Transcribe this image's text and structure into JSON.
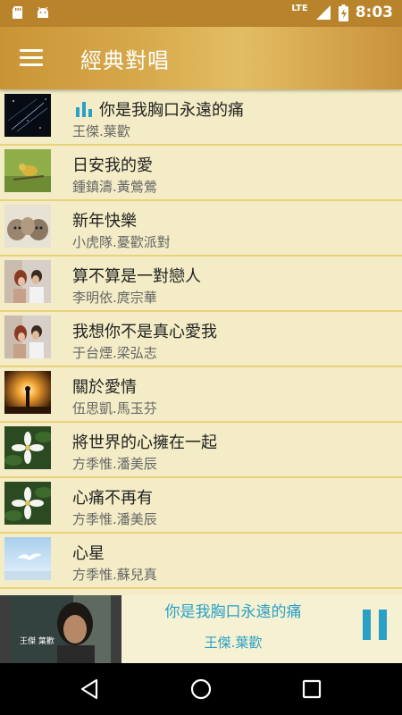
{
  "status_bar": {
    "network": "LTE",
    "time": "8:03",
    "icons": [
      "sd-card-icon",
      "android-icon",
      "signal-icon",
      "battery-icon"
    ]
  },
  "app_bar": {
    "title": "經典對唱",
    "menu_icon": "hamburger-menu-icon"
  },
  "songs": [
    {
      "title": "你是我胸口永遠的痛",
      "artist": "王傑.葉歡",
      "playing": true,
      "thumb": "starry-night"
    },
    {
      "title": "日安我的愛",
      "artist": "鍾鎮濤.黃鶯鶯",
      "playing": false,
      "thumb": "yellow-bird"
    },
    {
      "title": "新年快樂",
      "artist": "小虎隊.憂歡派對",
      "playing": false,
      "thumb": "tiger-cubs"
    },
    {
      "title": "算不算是一對戀人",
      "artist": "李明依.庹宗華",
      "playing": false,
      "thumb": "couple"
    },
    {
      "title": "我想你不是真心愛我",
      "artist": "于台煙.梁弘志",
      "playing": false,
      "thumb": "couple"
    },
    {
      "title": "關於愛情",
      "artist": "伍思凱.馬玉芬",
      "playing": false,
      "thumb": "sunset-silhouette"
    },
    {
      "title": "將世界的心擁在一起",
      "artist": "方季惟.潘美辰",
      "playing": false,
      "thumb": "white-flower"
    },
    {
      "title": "心痛不再有",
      "artist": "方季惟.潘美辰",
      "playing": false,
      "thumb": "white-flower"
    },
    {
      "title": "心星",
      "artist": "方季惟.蘇兒真",
      "playing": false,
      "thumb": "seagull-sky"
    }
  ],
  "player": {
    "title": "你是我胸口永遠的痛",
    "artist": "王傑.葉歡",
    "thumb_caption": "王傑 葉歡",
    "accent_color": "#2aa0c7"
  },
  "nav_bar": {
    "icons": [
      "back-icon",
      "home-icon",
      "recents-icon"
    ]
  }
}
